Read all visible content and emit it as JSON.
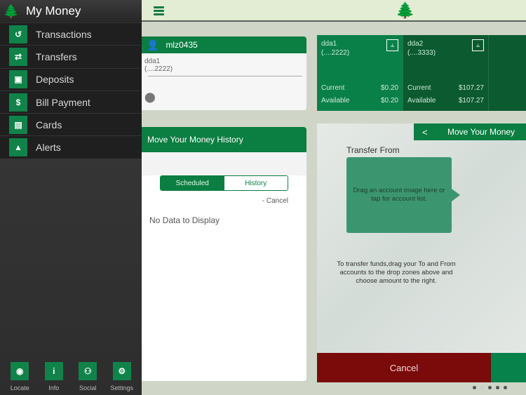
{
  "sidebar": {
    "title": "My Money",
    "logo_icon": "cedar-tree-icon",
    "items": [
      {
        "label": "Transactions",
        "icon": "history-icon"
      },
      {
        "label": "Transfers",
        "icon": "transfer-arrows-icon"
      },
      {
        "label": "Deposits",
        "icon": "cash-icon"
      },
      {
        "label": "Bill Payment",
        "icon": "bill-icon"
      },
      {
        "label": "Cards",
        "icon": "cards-icon"
      },
      {
        "label": "Alerts",
        "icon": "warning-icon"
      }
    ],
    "footer": [
      {
        "label": "Locate",
        "icon": "location-pin-icon"
      },
      {
        "label": "Info",
        "icon": "info-icon"
      },
      {
        "label": "Social",
        "icon": "people-icon"
      },
      {
        "label": "Settings",
        "icon": "gear-icon"
      }
    ]
  },
  "topbar": {
    "menu_icon": "hamburger-icon",
    "brand_icon": "cedar-tree-icon"
  },
  "user_card": {
    "username": "mlz0435",
    "account_name": "dda1",
    "account_number": "(....2222)"
  },
  "accounts": [
    {
      "name": "dda1",
      "number": "(....2222)",
      "current_label": "Current",
      "current": "$0.20",
      "available_label": "Available",
      "available": "$0.20",
      "color": "#0a8049"
    },
    {
      "name": "dda2",
      "number": "(....3333)",
      "current_label": "Current",
      "current": "$107.27",
      "available_label": "Available",
      "available": "$107.27",
      "color": "#0b5a30"
    }
  ],
  "history": {
    "title": "Move Your Money History",
    "tabs": [
      "Scheduled",
      "History"
    ],
    "active_tab": "Scheduled",
    "cancel_link": "- Cancel",
    "empty": "No Data to Display"
  },
  "mover": {
    "back": "<",
    "title": "Move Your Money",
    "transfer_from": "Transfer From",
    "drop_text": "Drag an account image here or tap for account list.",
    "instructions": "To transfer funds,drag your To and From accounts to the drop zones above and choose amount to the right.",
    "cancel": "Cancel"
  },
  "pager": {
    "pages": 5,
    "current": 2
  },
  "colors": {
    "primary": "#0b7e41",
    "cancel": "#7b0a0a"
  }
}
